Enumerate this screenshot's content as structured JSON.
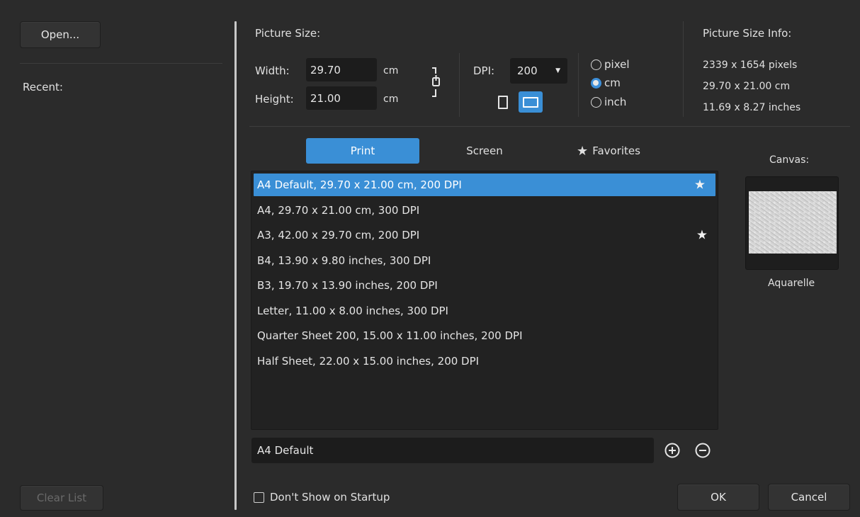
{
  "left": {
    "open_label": "Open...",
    "recent_label": "Recent:",
    "clear_list_label": "Clear List"
  },
  "size": {
    "section_title": "Picture Size:",
    "width_label": "Width:",
    "width_value": "29.70",
    "width_unit": "cm",
    "height_label": "Height:",
    "height_value": "21.00",
    "height_unit": "cm",
    "dpi_label": "DPI:",
    "dpi_value": "200",
    "orientation_selected": "landscape",
    "units": [
      {
        "label": "pixel",
        "checked": false
      },
      {
        "label": "cm",
        "checked": true
      },
      {
        "label": "inch",
        "checked": false
      }
    ]
  },
  "info": {
    "title": "Picture Size Info:",
    "pixels": "2339 x 1654 pixels",
    "cm": "29.70 x 21.00 cm",
    "inches": "11.69 x 8.27 inches"
  },
  "tabs": [
    {
      "label": "Print",
      "active": true
    },
    {
      "label": "Screen",
      "active": false
    },
    {
      "label": "Favorites",
      "active": false,
      "icon": "star-icon"
    }
  ],
  "presets": [
    {
      "label": "A4 Default, 29.70 x 21.00 cm, 200 DPI",
      "selected": true,
      "favorite": true
    },
    {
      "label": "A4, 29.70 x 21.00 cm, 300 DPI",
      "selected": false,
      "favorite": false
    },
    {
      "label": "A3, 42.00 x 29.70 cm, 200 DPI",
      "selected": false,
      "favorite": true
    },
    {
      "label": "B4, 13.90 x 9.80 inches, 300 DPI",
      "selected": false,
      "favorite": false
    },
    {
      "label": "B3, 19.70 x 13.90 inches, 200 DPI",
      "selected": false,
      "favorite": false
    },
    {
      "label": "Letter, 11.00 x 8.00 inches, 300 DPI",
      "selected": false,
      "favorite": false
    },
    {
      "label": "Quarter Sheet 200, 15.00 x 11.00 inches, 200 DPI",
      "selected": false,
      "favorite": false
    },
    {
      "label": "Half Sheet, 22.00 x 15.00 inches, 200 DPI",
      "selected": false,
      "favorite": false
    }
  ],
  "preset_name_value": "A4 Default",
  "canvas": {
    "title": "Canvas:",
    "name": "Aquarelle"
  },
  "footer": {
    "dont_show_label": "Don't Show on Startup",
    "dont_show_checked": false,
    "ok_label": "OK",
    "cancel_label": "Cancel"
  },
  "colors": {
    "accent": "#3a8fd6",
    "background": "#2b2b2b",
    "field": "#1c1c1c"
  }
}
